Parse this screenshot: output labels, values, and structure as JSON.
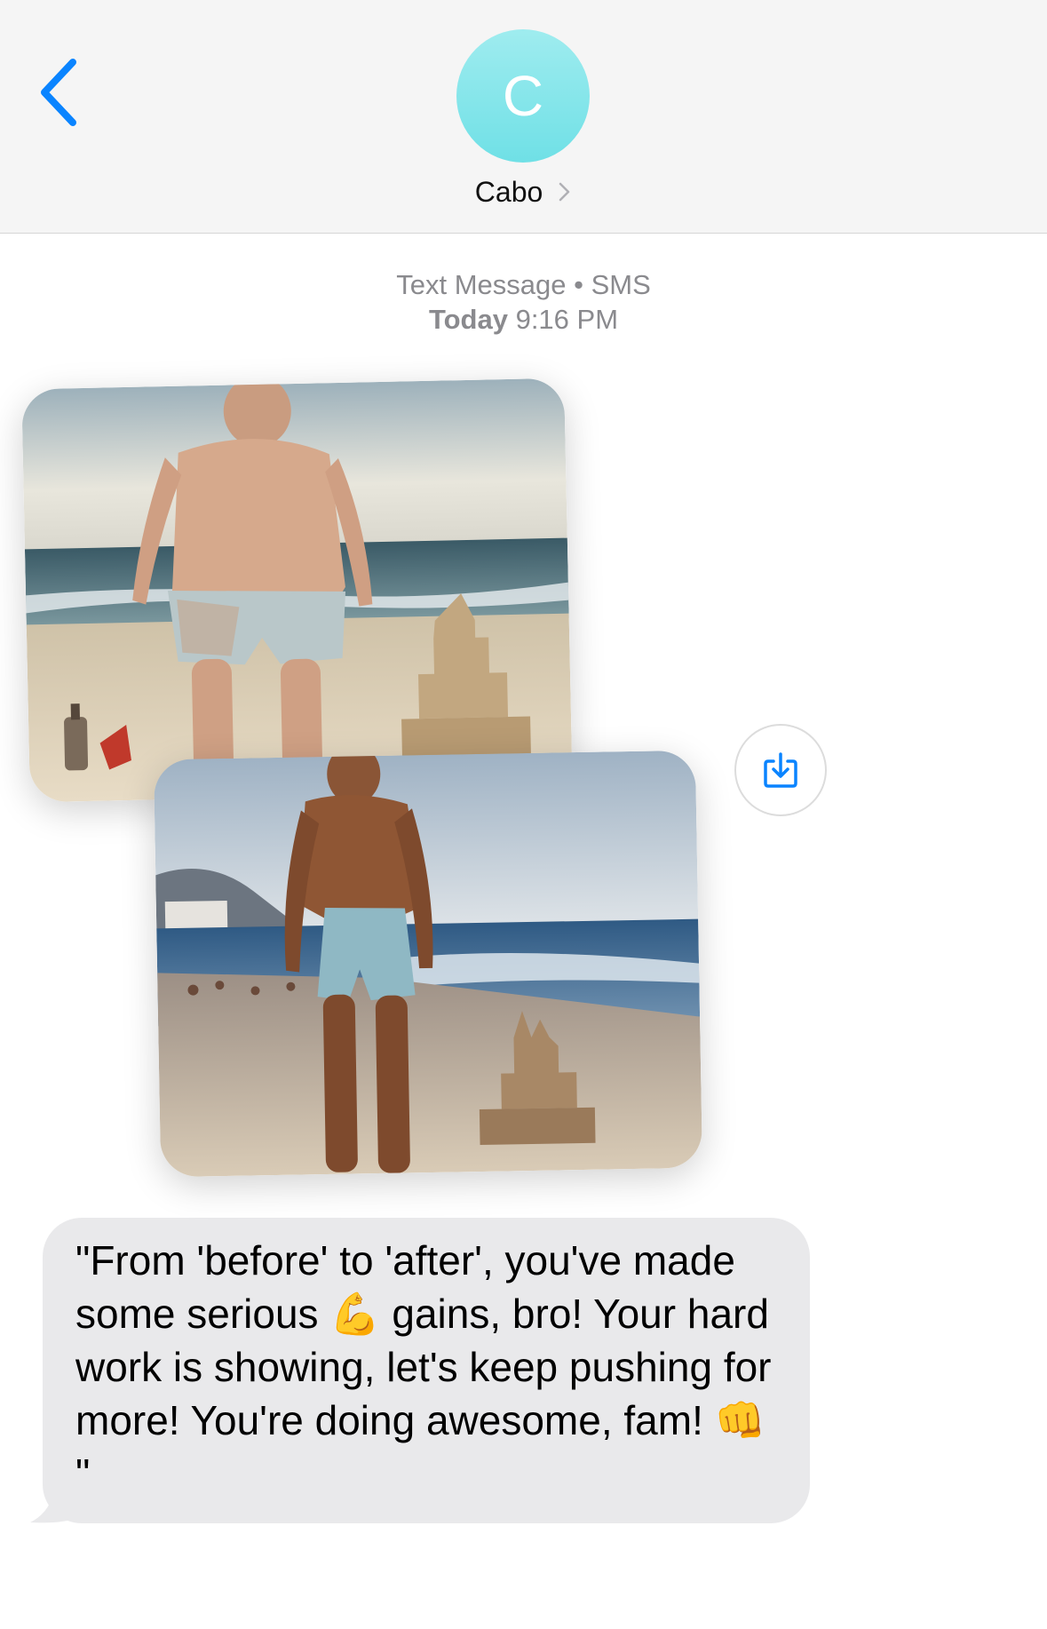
{
  "header": {
    "back_icon": "chevron-left-icon",
    "avatar_letter": "C",
    "contact_name": "Cabo",
    "contact_chevron_icon": "chevron-right-icon"
  },
  "meta": {
    "service_label": "Text Message • SMS",
    "day": "Today",
    "time": "9:16 PM"
  },
  "attachments": [
    {
      "name": "before-photo",
      "description": "beach photo",
      "kind": "image"
    },
    {
      "name": "after-photo",
      "description": "beach photo",
      "kind": "image"
    }
  ],
  "save_icon": "download-icon",
  "message": {
    "text": "\"From 'before' to 'after', you've made some serious 💪 gains, bro! Your hard work is showing, let's keep pushing for more! You're doing awesome, fam! 👊 \""
  },
  "colors": {
    "accent": "#0a84ff",
    "avatar": "#7ce4ea",
    "header_bg": "#f5f5f5",
    "bubble_bg": "#e9e9eb",
    "meta_text": "#8a8a8e"
  }
}
